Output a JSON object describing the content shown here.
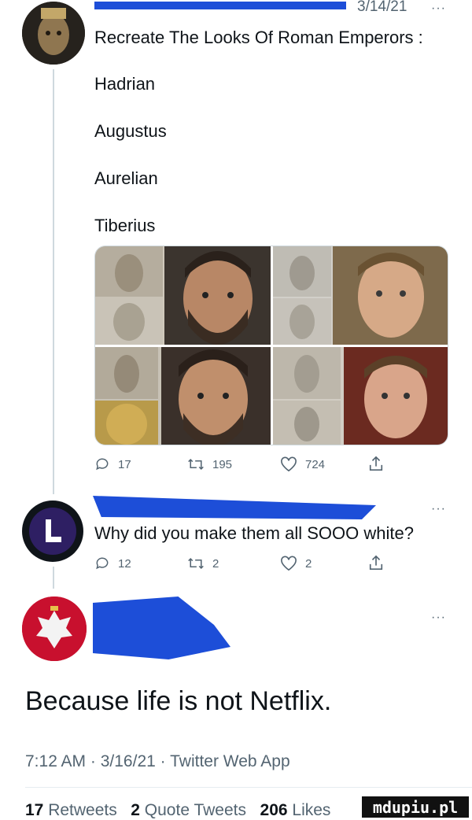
{
  "tweet1": {
    "date": "3/14/21",
    "more": "···",
    "text": "Recreate The Looks Of Roman Emperors :",
    "emperors": [
      "Hadrian",
      "Augustus",
      "Aurelian",
      "Tiberius"
    ],
    "replies": "17",
    "retweets": "195",
    "likes": "724"
  },
  "tweet2": {
    "more": "···",
    "text": "Why did you make them all SOOO white?",
    "replies": "12",
    "retweets": "2",
    "likes": "2",
    "avatar_letter": "L"
  },
  "main_tweet": {
    "more": "···",
    "text": "Because life is not Netflix.",
    "time": "7:12 AM",
    "date": "3/16/21",
    "app": "Twitter Web App",
    "retweets_count": "17",
    "retweets_label": "Retweets",
    "quotes_count": "2",
    "quotes_label": "Quote Tweets",
    "likes_count": "206",
    "likes_label": "Likes"
  },
  "watermark": "mdupiu.pl",
  "colors": {
    "redaction": "#1d4ed8",
    "meta": "#536471",
    "text": "#0f1419"
  }
}
